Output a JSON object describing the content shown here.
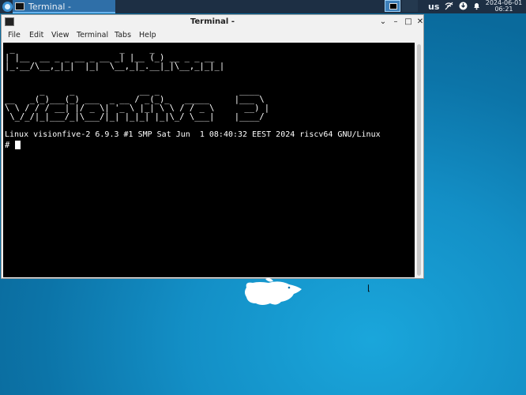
{
  "panel": {
    "task_title": "Terminal -",
    "keyboard_layout": "us",
    "clock_date": "2024-06-01",
    "clock_time": "06:21"
  },
  "window": {
    "title": "Terminal -",
    "menu": [
      "File",
      "Edit",
      "View",
      "Terminal",
      "Tabs",
      "Help"
    ]
  },
  "terminal": {
    "banner_lines": [
      " _                     _     _              ",
      "| |__  __ _ _ __ _ __ _| |__ (_) __ _ _ __  ",
      "|_.__/\\__,_|_|  |_|  \\__,_|_.__|_|\\__,_|_|_| ",
      "",
      "       _     _             __ _                ____  ",
      "__   _(_)___(_) ___  _ __ / _(_)_   _____     |___ \\ ",
      "\\ \\ / / / __| |/ _ \\| '_ \\ |_| \\ \\ / / _ \\      __) |",
      " \\_/_/|_|___/_|\\___/|_| |_|_| |_|\\_/ \\___|    |____/ "
    ],
    "uname_line": "Linux visionfive-2 6.9.3 #1 SMP Sat Jun  1 08:40:32 EEST 2024 riscv64 GNU/Linux",
    "prompt": "#"
  },
  "colors": {
    "panel_bg": "#1d2f44",
    "desktop_bg": "#138fc6",
    "terminal_bg": "#000000",
    "terminal_fg": "#ffffff"
  }
}
